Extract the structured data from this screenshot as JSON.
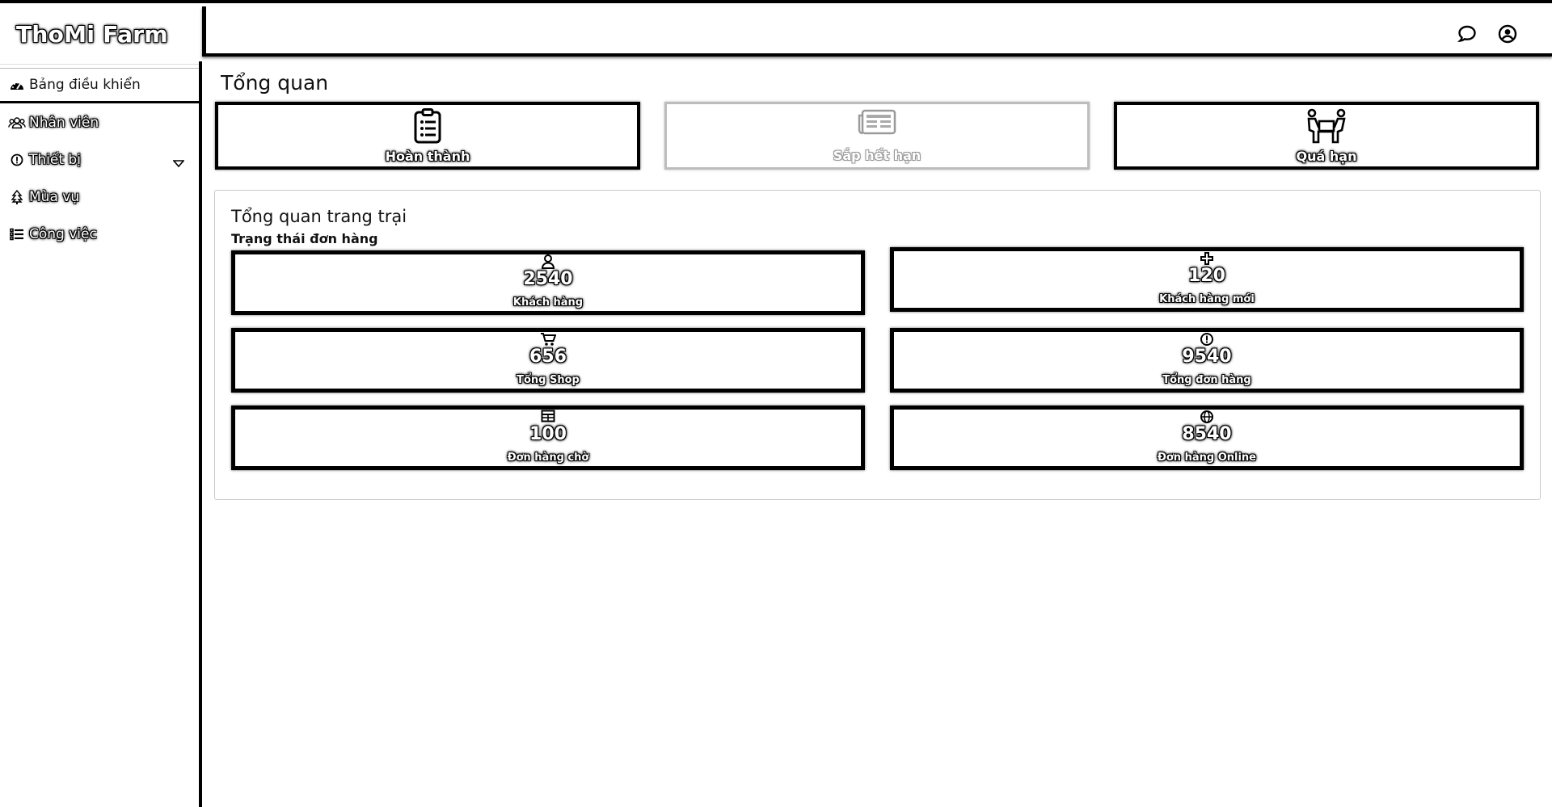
{
  "app": {
    "brand": "ThoMi Farm"
  },
  "topbar": {
    "icons": [
      "chat-bubble-icon",
      "user-circle-icon"
    ]
  },
  "sidebar": {
    "items": [
      {
        "label": "Bảng điều khiển",
        "icon": "dashboard-icon",
        "active": true
      },
      {
        "label": "Nhân viên",
        "icon": "users-icon"
      },
      {
        "label": "Thiết bị",
        "icon": "info-icon",
        "has_dropdown": true
      },
      {
        "label": "Mùa vụ",
        "icon": "tree-icon"
      },
      {
        "label": "Công việc",
        "icon": "task-list-icon"
      }
    ]
  },
  "main": {
    "title": "Tổng quan",
    "status_cards": [
      {
        "label": "Hoàn thành",
        "icon": "clipboard-list-icon"
      },
      {
        "label": "Sắp hết hạn",
        "icon": "newspaper-icon"
      },
      {
        "label": "Quá hạn",
        "icon": "people-carry-icon"
      }
    ],
    "panel": {
      "title": "Tổng quan trang trại",
      "subtitle": "Trạng thái đơn hàng",
      "metrics": [
        {
          "value": "2540",
          "label": "Khách hàng",
          "icon": "user-icon"
        },
        {
          "value": "120",
          "label": "Khách hàng mới",
          "icon": "plus-icon"
        },
        {
          "value": "656",
          "label": "Tổng Shop",
          "icon": "cart-icon"
        },
        {
          "value": "9540",
          "label": "Tổng đơn hàng",
          "icon": "info-icon"
        },
        {
          "value": "100",
          "label": "Đơn hàng chờ",
          "icon": "table-icon"
        },
        {
          "value": "8540",
          "label": "Đơn hàng Online",
          "icon": "globe-icon"
        }
      ]
    }
  }
}
